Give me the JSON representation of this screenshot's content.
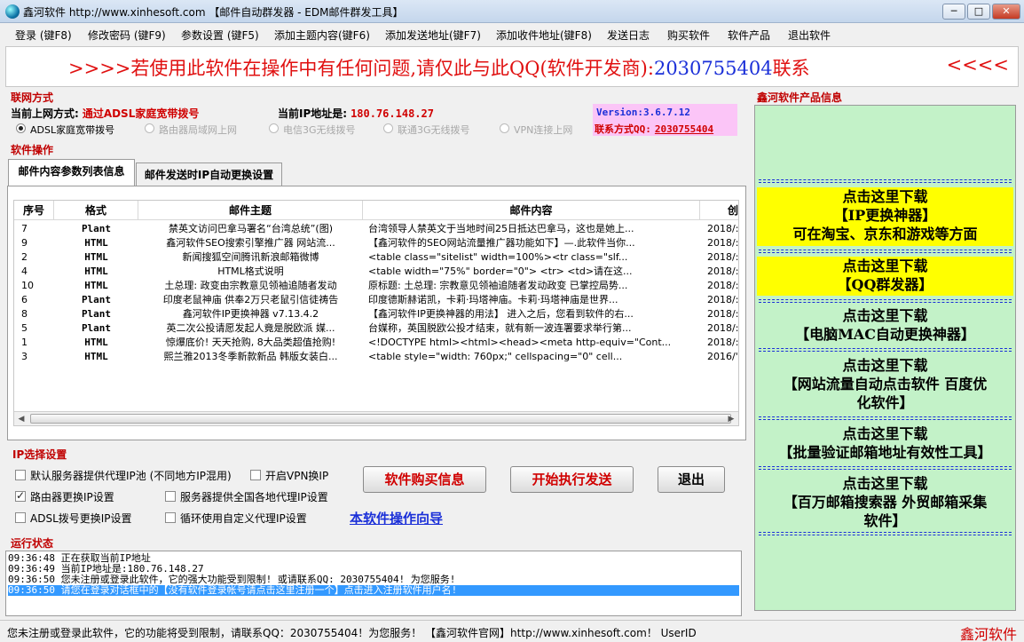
{
  "window": {
    "title": "鑫河软件 http://www.xinhesoft.com 【邮件自动群发器 - EDM邮件群发工具】",
    "minimize": "─",
    "maximize": "□",
    "close": "✕"
  },
  "menu": [
    "登录 (键F8)",
    "修改密码 (键F9)",
    "参数设置 (键F5)",
    "添加主题内容(键F6)",
    "添加发送地址(键F7)",
    "添加收件地址(键F8)",
    "发送日志",
    "购买软件",
    "软件产品",
    "退出软件"
  ],
  "banner": {
    "left": ">>>>若使用此软件在操作中有任何问题,请仅此与此QQ(软件开发商):",
    "qq": "2030755404",
    "suffix": "联系",
    "right": "<<<<"
  },
  "network": {
    "section": "联网方式",
    "current_mode_label": "当前上网方式:",
    "current_mode_value": "通过ADSL家庭宽带拨号",
    "ip_label": "当前IP地址是:",
    "ip_value": "180.76.148.27",
    "version": "Version:3.6.7.12",
    "contact_label": "联系方式QQ:",
    "contact_value": "2030755404",
    "options": [
      "ADSL家庭宽带拨号",
      "路由器局域网上网",
      "电信3G无线拨号",
      "联通3G无线拨号",
      "VPN连接上网"
    ],
    "selected": "ADSL家庭宽带拨号"
  },
  "ops": {
    "section": "软件操作",
    "tabs": [
      "邮件内容参数列表信息",
      "邮件发送时IP自动更换设置"
    ]
  },
  "table": {
    "columns": [
      "序号",
      "格式",
      "邮件主题",
      "邮件内容",
      "创"
    ],
    "rows": [
      [
        "7",
        "Plant",
        "禁英文访问巴拿马署名“台湾总统”(图)",
        "台湾领导人禁英文于当地时间25日抵达巴拿马，这也是她上...",
        "2018/:"
      ],
      [
        "9",
        "HTML",
        "鑫河软件SEO搜索引擎推广器 网站流...",
        "【鑫河软件的SEO网站流量推广器功能如下】—.此软件当你...",
        "2018/:"
      ],
      [
        "2",
        "HTML",
        "新闻搜狐空间腾讯新浪邮箱微博",
        "<table class=\"sitelist\" width=100%><tr class=\"slf...",
        "2018/:"
      ],
      [
        "4",
        "HTML",
        "HTML格式说明",
        "<table width=\"75%\" border=\"0\">  <tr>    <td>请在这...",
        "2018/:"
      ],
      [
        "10",
        "HTML",
        "土总理: 政变由宗教意见领袖追随者发动",
        "原标题: 土总理: 宗教意见领袖追随者发动政变 已掌控局势...",
        "2018/:"
      ],
      [
        "6",
        "Plant",
        "印度老鼠神庙 供奉2万只老鼠引信徒祷告",
        "印度德斯赫诺凯，卡莉·玛塔神庙。卡莉·玛塔神庙是世界...",
        "2018/:"
      ],
      [
        "8",
        "Plant",
        "鑫河软件IP更换神器 v7.13.4.2",
        "【鑫河软件IP更换神器的用法】 进入之后，您看到软件的右...",
        "2018/:"
      ],
      [
        "5",
        "Plant",
        "英二次公投请愿发起人竟是脱欧派 媒...",
        "台媒称，英国脱欧公投才结束，就有新一波连署要求举行第...",
        "2018/:"
      ],
      [
        "1",
        "HTML",
        "惊爆底价! 天天抢购, 8大品类超值抢购!",
        "<!DOCTYPE html><html><head><meta http-equiv=\"Cont...",
        "2018/:"
      ],
      [
        "3",
        "HTML",
        "熙兰雅2013冬季新款新品 韩版女装白...",
        "<table style=\"width: 760px;\" cellspacing=\"0\" cell...",
        "2016/'"
      ]
    ]
  },
  "ipset": {
    "section": "IP选择设置",
    "checks": [
      {
        "label": "默认服务器提供代理IP池 (不同地方IP混用)",
        "on": false
      },
      {
        "label": "开启VPN换IP",
        "on": false
      },
      {
        "label": "路由器更换IP设置",
        "on": true
      },
      {
        "label": "服务器提供全国各地代理IP设置",
        "on": false
      },
      {
        "label": "ADSL拨号更换IP设置",
        "on": false
      },
      {
        "label": "循环使用自定义代理IP设置",
        "on": false
      }
    ],
    "buy_button": "软件购买信息",
    "start_button": "开始执行发送",
    "exit_button": "退出",
    "guide_link": "本软件操作向导"
  },
  "log": {
    "section": "运行状态",
    "lines": [
      "09:36:48 正在获取当前IP地址",
      "09:36:49 当前IP地址是:180.76.148.27",
      "09:36:50 您未注册或登录此软件，它的强大功能受到限制! 或请联系QQ: 2030755404! 为您服务!",
      "09:36:50 请您在登录对话框中的【没有软件登录帐号请点击这里注册一个】点击进入注册软件用户名!"
    ]
  },
  "products": {
    "section": "鑫河软件产品信息",
    "divider": "================================================",
    "items": [
      {
        "lines": [
          "点击这里下载",
          "【IP更换神器】",
          "可在淘宝、京东和游戏等方面"
        ],
        "highlight": true
      },
      {
        "lines": [
          "点击这里下载",
          "【QQ群发器】"
        ],
        "highlight": true
      },
      {
        "lines": [
          "点击这里下载",
          "【电脑MAC自动更换神器】"
        ],
        "highlight": false
      },
      {
        "lines": [
          "点击这里下载",
          "【网站流量自动点击软件 百度优",
          "化软件】"
        ],
        "highlight": false
      },
      {
        "lines": [
          "点击这里下载",
          "【批量验证邮箱地址有效性工具】"
        ],
        "highlight": false
      },
      {
        "lines": [
          "点击这里下载",
          "【百万邮箱搜索器 外贸邮箱采集",
          "软件】"
        ],
        "highlight": false
      }
    ]
  },
  "status": {
    "text": "您未注册或登录此软件，它的功能将受到限制，请联系QQ：2030755404！为您服务！ 【鑫河软件官网】http://www.xinhesoft.com！  UserID",
    "brand": "鑫河软件"
  },
  "colors": {
    "accent_red": "#d00000",
    "link_blue": "#1a2fd8",
    "panel_green": "#c3f2c8",
    "highlight_yellow": "#ffff00",
    "version_pink": "#fbc5f7",
    "selection_blue": "#3399ff"
  }
}
